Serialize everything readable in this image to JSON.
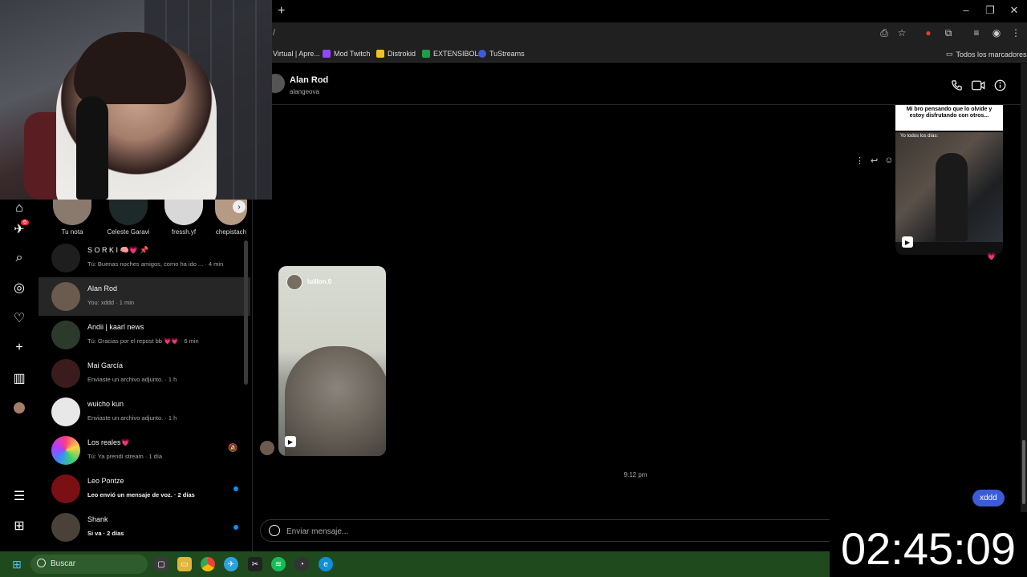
{
  "browser": {
    "url_fragment": "/",
    "bookmarks": [
      {
        "label": "Virtual | Apre...",
        "color": "#555555"
      },
      {
        "label": "Mod Twitch",
        "color": "#9146ff"
      },
      {
        "label": "Distrokid",
        "color": "#f0c419"
      },
      {
        "label": "EXTENSIBOL",
        "color": "#1e9e4a"
      },
      {
        "label": "TuStreams",
        "color": "#3b5bdb"
      }
    ],
    "all_bookmarks": "Todos los marcadores"
  },
  "rail": {
    "notification_count": "6"
  },
  "notes": [
    {
      "label": "Tu nota"
    },
    {
      "label": "Celeste Garavi"
    },
    {
      "label": "fressh.yf"
    },
    {
      "label": "chepistach"
    }
  ],
  "conversations": [
    {
      "name": "S O R K I 🧠💗 📌",
      "preview": "Tú: Buenas noches amigos, como ha ido ... · 4 min",
      "bold": false,
      "active": false,
      "dot": false,
      "muted": false
    },
    {
      "name": "Alan Rod",
      "preview": "You: xddd · 1 min",
      "bold": false,
      "active": true,
      "dot": false,
      "muted": false
    },
    {
      "name": "Andii | kaarl news",
      "preview": "Tú: Gracias por el repost bb 💗💗 · 6 min",
      "bold": false,
      "active": false,
      "dot": false,
      "muted": false
    },
    {
      "name": "Mai García",
      "preview": "Enviaste un archivo adjunto. · 1 h",
      "bold": false,
      "active": false,
      "dot": false,
      "muted": false
    },
    {
      "name": "wuicho kun",
      "preview": "Enviaste un archivo adjunto. · 1 h",
      "bold": false,
      "active": false,
      "dot": false,
      "muted": false
    },
    {
      "name": "Los reales💗",
      "preview": "Tú: Ya prendí stream · 1 día",
      "bold": false,
      "active": false,
      "dot": false,
      "muted": true
    },
    {
      "name": "Leo Pontze",
      "preview": "Leo envió un mensaje de voz. · 2 días",
      "bold": true,
      "active": false,
      "dot": true,
      "muted": false
    },
    {
      "name": "Shank",
      "preview": "Si va · 2 días",
      "bold": true,
      "active": false,
      "dot": true,
      "muted": false
    }
  ],
  "chat": {
    "name": "Alan Rod",
    "username": "alangeova",
    "reel_right_caption": "Mi bro pensando que lo olvide y estoy disfrutando  con otros...",
    "reel_right_subcaption": "Yo todos los días:",
    "reel_left_user": "luillon.0",
    "timestamp": "9:12 pm",
    "my_message": "xddd",
    "composer_placeholder": "Enviar mensaje..."
  },
  "taskbar": {
    "search_label": "Buscar"
  },
  "clock": "02:45:09"
}
